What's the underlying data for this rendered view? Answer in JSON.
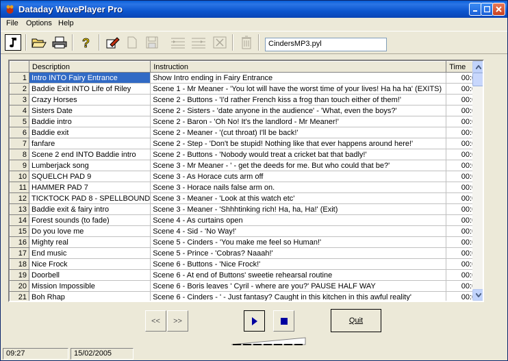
{
  "window": {
    "title": "Dataday WavePlayer Pro"
  },
  "menu": [
    "File",
    "Options",
    "Help"
  ],
  "toolbar": {
    "filename": "CindersMP3.pyl"
  },
  "grid": {
    "columns": {
      "description": "Description",
      "instruction": "Instruction",
      "time": "Time"
    },
    "rows": [
      {
        "num": "1",
        "description": "Intro INTO Fairy Entrance",
        "instruction": "Show Intro ending in Fairy Entrance",
        "time": "00:0"
      },
      {
        "num": "2",
        "description": "Baddie Exit INTO Life of Riley",
        "instruction": "Scene 1 - Mr Meaner - 'You lot will have the worst time of your lives! Ha ha ha' (EXITS)",
        "time": "00:0"
      },
      {
        "num": "3",
        "description": "Crazy Horses",
        "instruction": "Scene 2 - Buttons - 'I'd rather French kiss a frog than touch either of them!'",
        "time": "00:0"
      },
      {
        "num": "4",
        "description": "Sisters Date",
        "instruction": "Scene 2 - Sisters - 'date anyone in the audience' - 'What, even the boys?'",
        "time": "00:0"
      },
      {
        "num": "5",
        "description": "Baddie intro",
        "instruction": "Scene 2 - Baron - 'Oh No!  It's the landlord - Mr Meaner!'",
        "time": "00:0"
      },
      {
        "num": "6",
        "description": "Baddie exit",
        "instruction": "Scene 2 - Meaner - '(cut throat)  I'll be back!'",
        "time": "00:0"
      },
      {
        "num": "7",
        "description": "fanfare",
        "instruction": "Scene 2 - Step - 'Don't be stupid!  Nothing like that ever happens around here!'",
        "time": "00:0"
      },
      {
        "num": "8",
        "description": "Scene 2 end INTO Baddie intro",
        "instruction": "Scene 2 - Buttons - 'Nobody would treat a cricket bat that badly!'",
        "time": "00:0"
      },
      {
        "num": "9",
        "description": "Lumberjack song",
        "instruction": "Scene 3 - Mr Meaner - ' - get the deeds for me.  But who could that be?'",
        "time": "00:0"
      },
      {
        "num": "10",
        "description": "SQUELCH  PAD 9",
        "instruction": "Scene 3 - As Horace cuts arm off",
        "time": "00:0"
      },
      {
        "num": "11",
        "description": "HAMMER PAD 7",
        "instruction": "Scene 3 - Horace nails false arm on.",
        "time": "00:0"
      },
      {
        "num": "12",
        "description": "TICKTOCK PAD 8 - SPELLBOUND",
        "instruction": "Scene 3 - Meaner - 'Look at this watch etc'",
        "time": "00:0"
      },
      {
        "num": "13",
        "description": "Baddie exit & fairy intro",
        "instruction": "Scene 3 - Meaner - 'Shhhtinking rich!  Ha, ha, Ha!'  (Exit)",
        "time": "00:0"
      },
      {
        "num": "14",
        "description": "Forest sounds (to fade)",
        "instruction": "Scene 4 - As curtains open",
        "time": "00:0"
      },
      {
        "num": "15",
        "description": "Do you love me",
        "instruction": "Scene 4 - Sid - 'No Way!'",
        "time": "00:0"
      },
      {
        "num": "16",
        "description": "Mighty real",
        "instruction": "Scene 5 - Cinders - 'You make me feel so Human!'",
        "time": "00:0"
      },
      {
        "num": "17",
        "description": "End music",
        "instruction": "Scene 5 - Prince - 'Cobras?   Naaah!'",
        "time": "00:0"
      },
      {
        "num": "18",
        "description": "Nice Frock",
        "instruction": "Scene 6 - Buttons - 'Nice Frock!'",
        "time": "00:0"
      },
      {
        "num": "19",
        "description": "Doorbell",
        "instruction": "Scene 6 - At end of Buttons' sweetie rehearsal routine",
        "time": "00:0"
      },
      {
        "num": "20",
        "description": "Mission Impossible",
        "instruction": "Scene 6 - Boris leaves ' Cyril - where are you?'  PAUSE HALF WAY",
        "time": "00:0"
      },
      {
        "num": "21",
        "description": "Boh Rhap",
        "instruction": "Scene 6 - Cinders - ' - Just fantasy?  Caught in this kitchen in this awful reality'",
        "time": "00:0"
      }
    ]
  },
  "controls": {
    "prev_label": "<<",
    "next_label": ">>",
    "quit_label": "Quit"
  },
  "status": {
    "time": "09:27",
    "date": "15/02/2005"
  }
}
